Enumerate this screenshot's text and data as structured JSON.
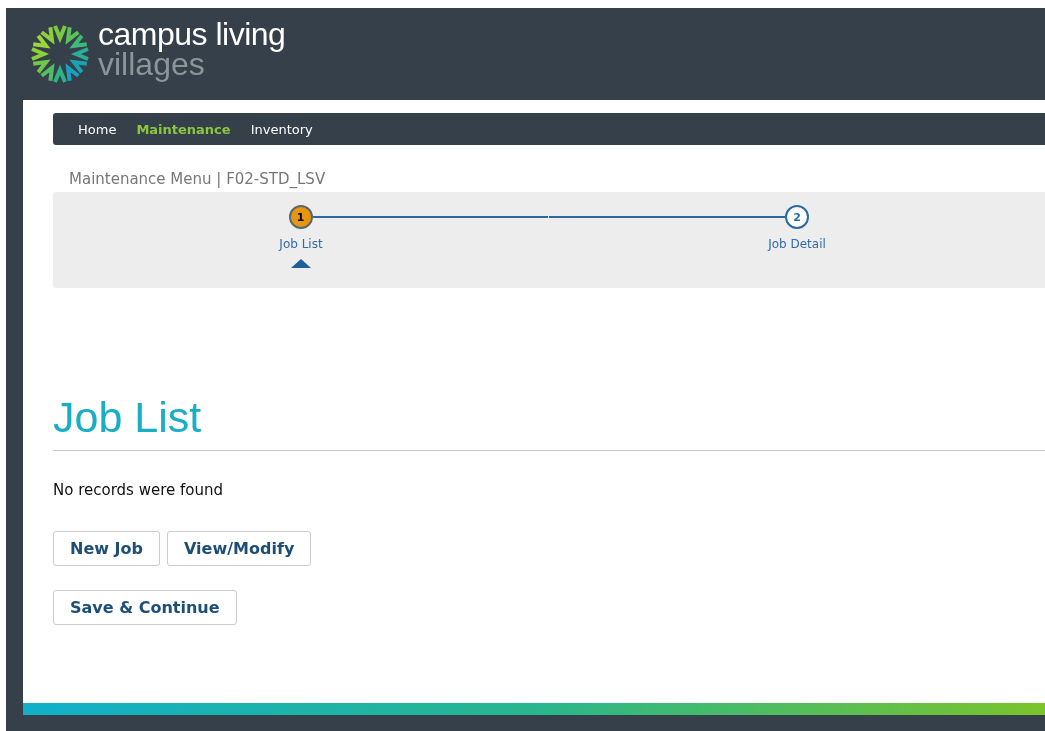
{
  "logo": {
    "line_1": "campus living",
    "line_2": "villages"
  },
  "nav": [
    {
      "label": "Home",
      "selected": false
    },
    {
      "label": "Maintenance",
      "selected": true
    },
    {
      "label": "Inventory",
      "selected": false
    }
  ],
  "breadcrumb": "Maintenance Menu | F02-STD_LSV",
  "steps": [
    {
      "number": "1",
      "label": "Job List",
      "selected": true
    },
    {
      "number": "2",
      "label": "Job Detail",
      "selected": false
    }
  ],
  "heading": "Job List",
  "message": "No records were found",
  "button_rows": [
    [
      "New Job",
      "View/Modify"
    ],
    [
      "Save & Continue"
    ]
  ]
}
